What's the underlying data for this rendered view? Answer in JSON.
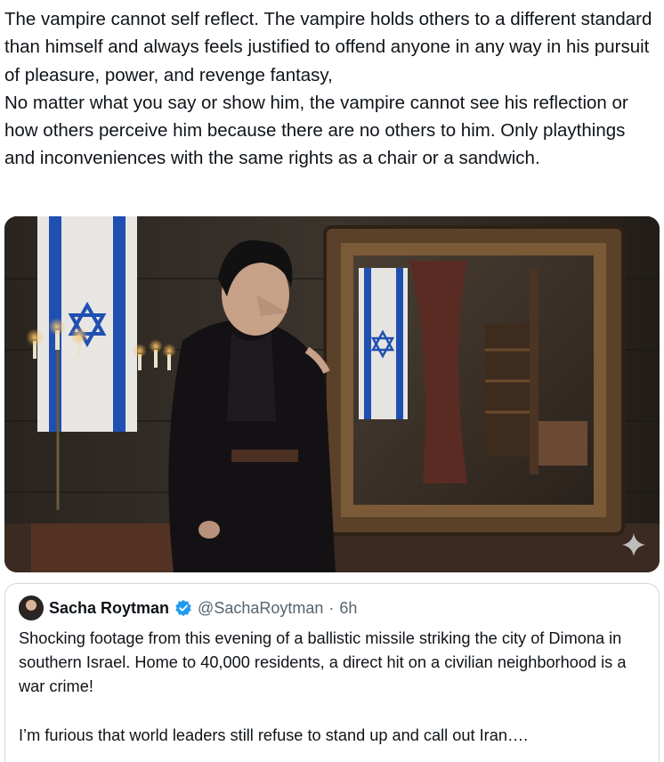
{
  "post": {
    "text": "The vampire cannot self reflect. The vampire holds others to a different standard than himself and always feels justified to offend anyone in any way in his pursuit of pleasure, power, and revenge fantasy,\nNo matter what you say or show him, the vampire cannot see his reflection or how others perceive him because there are no others to him. Only playthings and inconveniences with the same rights as a chair or a sandwich."
  },
  "media": {
    "icon": "sparkle-icon"
  },
  "quote": {
    "name": "Sacha Roytman",
    "handle": "@SachaRoytman",
    "separator": "·",
    "time": "6h",
    "text": "Shocking footage from this evening of a ballistic missile striking the city of Dimona in southern Israel. Home to 40,000 residents, a direct hit on a civilian neighborhood is a war crime!\n\nI’m furious that world leaders still refuse to stand up and call out Iran….",
    "verified_color": "#1d9bf0"
  }
}
